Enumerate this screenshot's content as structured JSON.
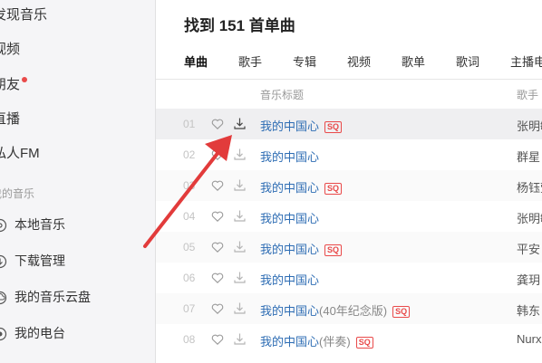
{
  "sidebar": {
    "items": [
      {
        "label": "发现音乐"
      },
      {
        "label": "视频"
      },
      {
        "label": "朋友",
        "has_dot": true
      },
      {
        "label": "直播"
      },
      {
        "label": "私人FM"
      }
    ],
    "section_label": "我的音乐",
    "my_music": [
      {
        "label": "本地音乐",
        "icon": "music-note-icon"
      },
      {
        "label": "下载管理",
        "icon": "download-icon"
      },
      {
        "label": "我的音乐云盘",
        "icon": "cloud-icon"
      },
      {
        "label": "我的电台",
        "icon": "radio-icon"
      }
    ]
  },
  "main": {
    "result_title": "找到 151 首单曲",
    "tabs": [
      {
        "label": "单曲",
        "active": true
      },
      {
        "label": "歌手"
      },
      {
        "label": "专辑"
      },
      {
        "label": "视频"
      },
      {
        "label": "歌单"
      },
      {
        "label": "歌词"
      },
      {
        "label": "主播电台"
      }
    ],
    "columns": {
      "title": "音乐标题",
      "artist": "歌手"
    },
    "songs": [
      {
        "num": "01",
        "title": "我的中国心",
        "sub": "",
        "sq": "SQ",
        "artist": "张明敏"
      },
      {
        "num": "02",
        "title": "我的中国心",
        "sub": "",
        "sq": "",
        "artist": "群星"
      },
      {
        "num": "03",
        "title": "我的中国心",
        "sub": "",
        "sq": "SQ",
        "artist": "杨钰莹"
      },
      {
        "num": "04",
        "title": "我的中国心",
        "sub": "",
        "sq": "",
        "artist": "张明敏"
      },
      {
        "num": "05",
        "title": "我的中国心",
        "sub": "",
        "sq": "SQ",
        "artist": "平安"
      },
      {
        "num": "06",
        "title": "我的中国心",
        "sub": "",
        "sq": "",
        "artist": "龚玥"
      },
      {
        "num": "07",
        "title": "我的中国心",
        "sub": "(40年纪念版)",
        "sq": "SQ",
        "artist": "韩东"
      },
      {
        "num": "08",
        "title": "我的中国心",
        "sub": "(伴奏)",
        "sq": "SQ",
        "artist": "Nurx"
      }
    ]
  },
  "colors": {
    "accent": "#e94a4a",
    "link": "#2e6db4",
    "arrow": "#e23b3b"
  }
}
